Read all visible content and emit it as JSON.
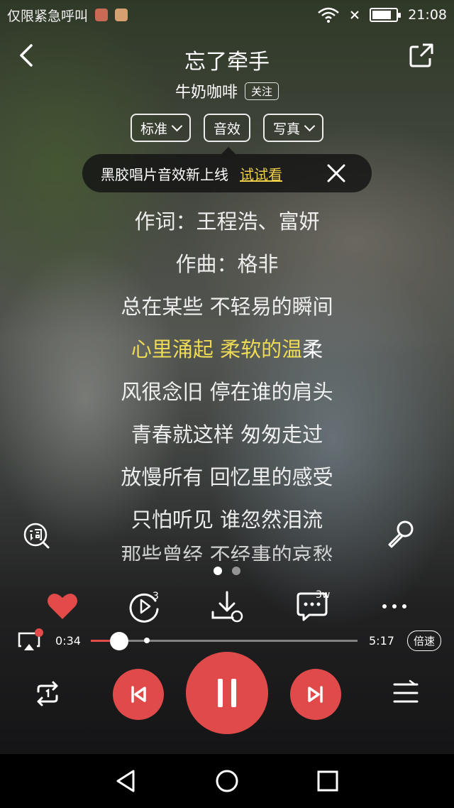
{
  "status_bar": {
    "carrier": "仅限紧急呼叫",
    "time": "21:08",
    "battery_level": 0.8
  },
  "header": {
    "title": "忘了牵手",
    "artist": "牛奶咖啡",
    "follow_label": "关注"
  },
  "options": {
    "quality_label": "标准",
    "effect_label": "音效",
    "photo_label": "写真"
  },
  "tip": {
    "text": "黑胶唱片音效新上线",
    "action_label": "试试看"
  },
  "lyrics": {
    "lines": [
      "作词：王程浩、富妍",
      "作曲：格非",
      "总在某些 不轻易的瞬间",
      "风很念旧 停在谁的肩头",
      "青春就这样 匆匆走过",
      "放慢所有 回忆里的感受",
      "只怕听见 谁忽然泪流",
      "那些曾经 不经事的哀愁"
    ],
    "current_sung": "心里涌起 柔软的温",
    "current_rest": "柔"
  },
  "actions": {
    "play_count_badge": "3",
    "comment_count_badge": "3w"
  },
  "player": {
    "elapsed": "0:34",
    "duration": "5:17",
    "progress": 0.107,
    "buffered": 0.21,
    "speed_label": "倍速"
  },
  "colors": {
    "accent": "#e04a4a",
    "lyric_highlight": "#eedb55",
    "tip_link": "#f0cf48"
  },
  "icons": [
    "back-icon",
    "share-icon",
    "close-icon",
    "lyric-icon",
    "mic-icon",
    "heart-icon",
    "play-loop-icon",
    "download-icon",
    "comment-icon",
    "more-icon",
    "cast-icon",
    "repeat-icon",
    "prev-icon",
    "pause-icon",
    "next-icon",
    "playlist-icon",
    "nav-back-icon",
    "nav-home-icon",
    "nav-recent-icon"
  ]
}
